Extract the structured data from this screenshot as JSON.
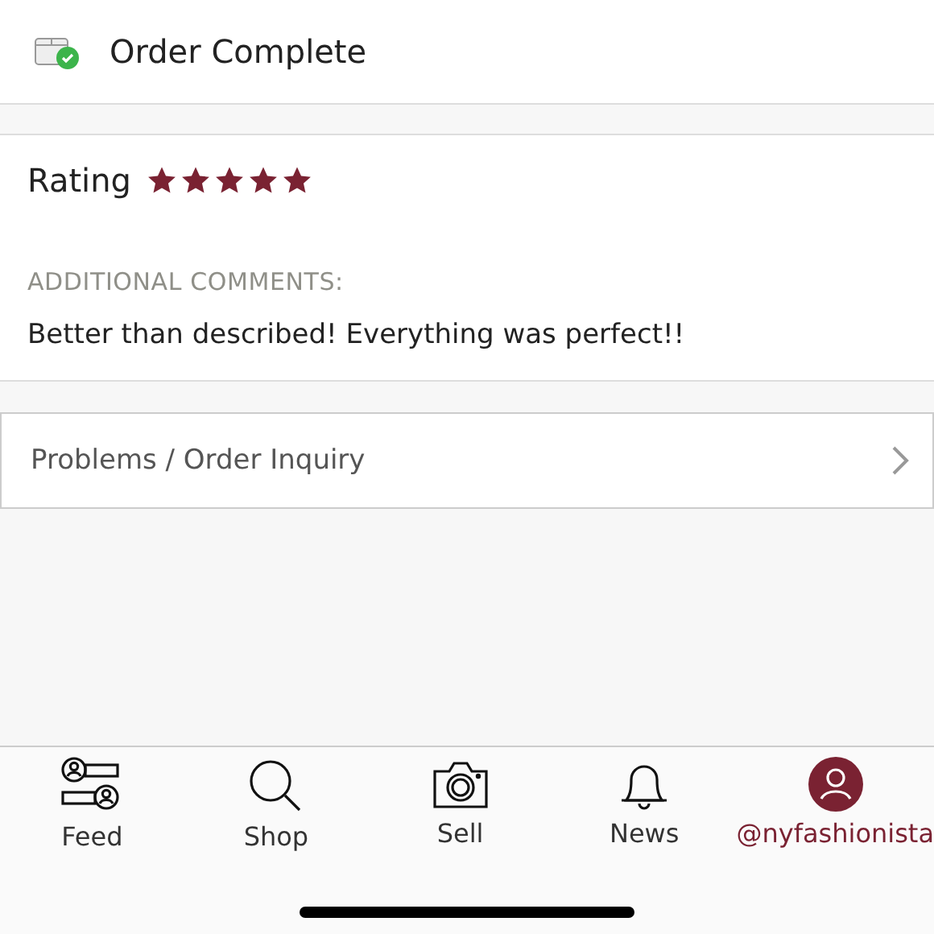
{
  "header": {
    "title": "Order Complete"
  },
  "rating": {
    "label": "Rating",
    "stars": 5
  },
  "comments": {
    "heading": "ADDITIONAL COMMENTS:",
    "text": "Better than described! Everything was perfect!!"
  },
  "inquiry": {
    "label": "Problems / Order Inquiry"
  },
  "tabs": [
    {
      "label": "Feed",
      "kind": "feed",
      "selected": false
    },
    {
      "label": "Shop",
      "kind": "shop",
      "selected": false
    },
    {
      "label": "Sell",
      "kind": "sell",
      "selected": false
    },
    {
      "label": "News",
      "kind": "news",
      "selected": false
    },
    {
      "label": "@nyfashionista",
      "kind": "profile",
      "selected": true
    }
  ]
}
